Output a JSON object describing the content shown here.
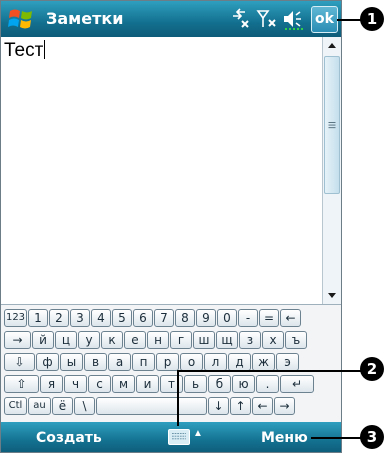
{
  "title_bar": {
    "app_title": "Заметки",
    "ok_label": "ok",
    "status_icons": [
      "connectivity-icon",
      "signal-off-icon",
      "volume-icon"
    ]
  },
  "note": {
    "text": "Тест"
  },
  "keyboard": {
    "rows": [
      [
        "123",
        "1",
        "2",
        "3",
        "4",
        "5",
        "6",
        "7",
        "8",
        "9",
        "0",
        "-",
        "=",
        "←"
      ],
      [
        "→",
        "й",
        "ц",
        "у",
        "к",
        "е",
        "н",
        "г",
        "ш",
        "щ",
        "з",
        "х",
        "ъ"
      ],
      [
        "⇩",
        "ф",
        "ы",
        "в",
        "а",
        "п",
        "р",
        "о",
        "л",
        "д",
        "ж",
        "э"
      ],
      [
        "⇧",
        "я",
        "ч",
        "с",
        "м",
        "и",
        "т",
        "ь",
        "б",
        "ю",
        ".",
        "↵"
      ],
      [
        "Ctl",
        "au",
        "ё",
        "\\",
        "",
        "↓",
        "↑",
        "←",
        "→"
      ]
    ]
  },
  "menu_bar": {
    "left_softkey": "Создать",
    "right_softkey": "Меню"
  },
  "callouts": [
    "1",
    "2",
    "3"
  ]
}
